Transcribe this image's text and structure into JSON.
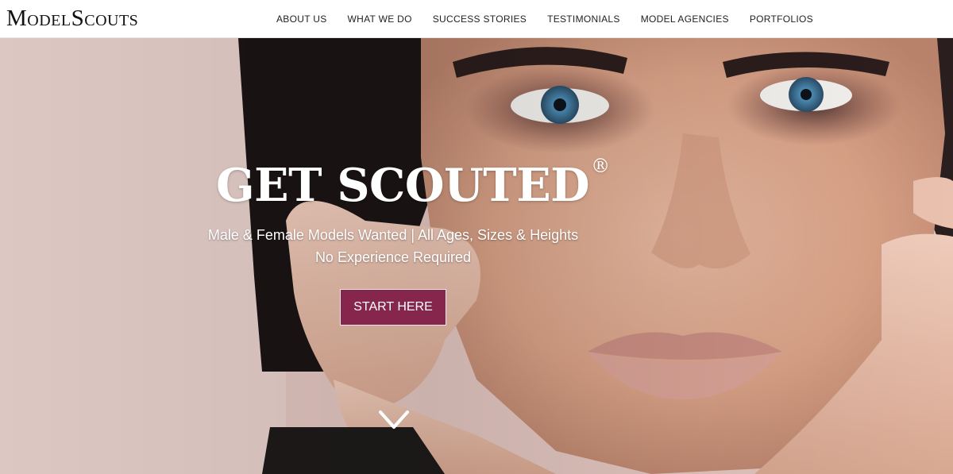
{
  "header": {
    "logo_text": "ModelScouts",
    "nav": [
      {
        "label": "ABOUT US"
      },
      {
        "label": "WHAT WE DO"
      },
      {
        "label": "SUCCESS STORIES"
      },
      {
        "label": "TESTIMONIALS"
      },
      {
        "label": "MODEL AGENCIES"
      },
      {
        "label": "PORTFOLIOS"
      }
    ]
  },
  "hero": {
    "headline": "GET SCOUTED",
    "registered_mark": "®",
    "subline_1": "Male & Female Models Wanted | All Ages, Sizes & Heights",
    "subline_2": "No Experience Required",
    "cta_label": "START HERE",
    "scroll_icon": "chevron-down-icon"
  },
  "colors": {
    "accent": "#86264d",
    "header_bg": "#ffffff",
    "hero_text": "#ffffff"
  }
}
